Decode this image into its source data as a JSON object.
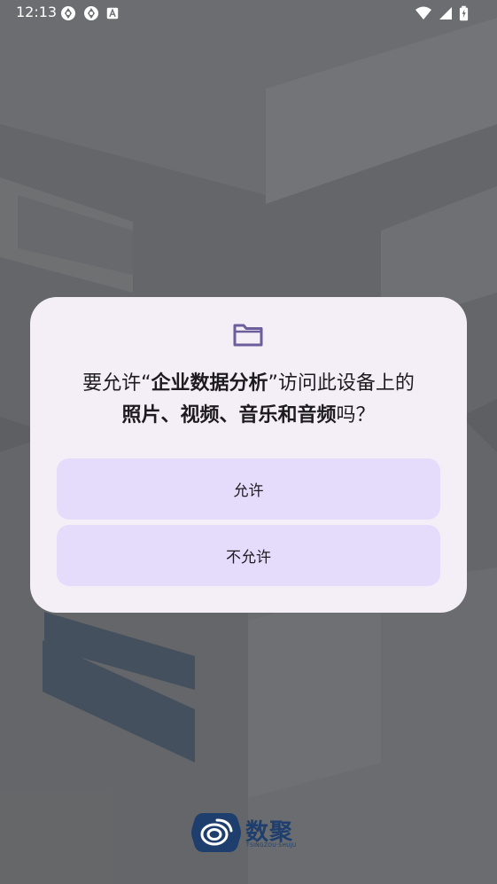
{
  "status_bar": {
    "time": "12:13",
    "left_icons": [
      "app-notification-icon",
      "app-notification-icon",
      "keyboard-a-icon"
    ],
    "right_icons": [
      "wifi-icon",
      "cell-signal-icon",
      "battery-charging-icon"
    ]
  },
  "dialog": {
    "icon": "folder-icon",
    "message_prefix": "要允许“",
    "app_name": "企业数据分析",
    "message_mid": "”访问此设备上的",
    "media_types": "照片、视频、音乐和音频",
    "message_suffix": "吗？",
    "allow_label": "允许",
    "deny_label": "不允许"
  },
  "brand": {
    "name": "数聚",
    "subtitle": "TSINGZOU·SHUJU"
  },
  "colors": {
    "dialog_bg": "#f4eff6",
    "button_bg": "#e5dcfc",
    "icon_accent": "#6a5e9c",
    "brand": "#1e3f6e"
  }
}
